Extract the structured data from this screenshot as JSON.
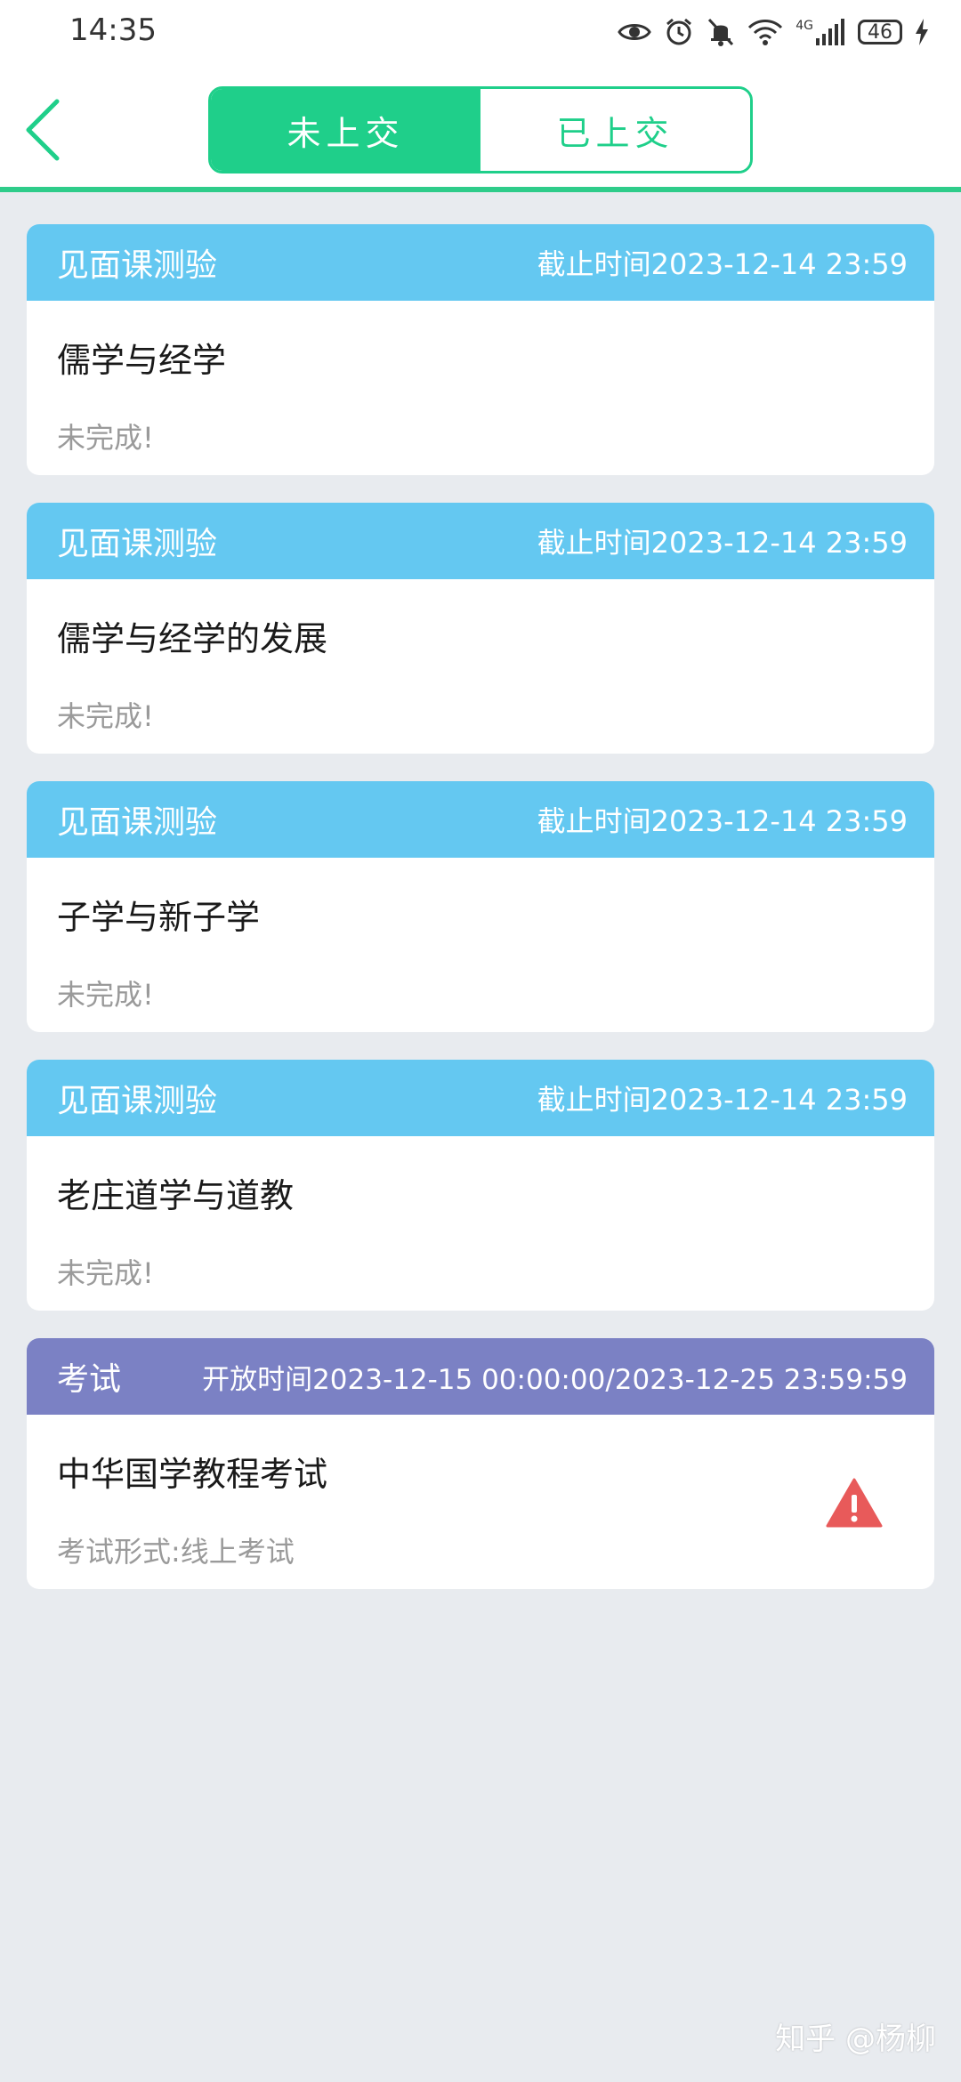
{
  "status_bar": {
    "time": "14:35",
    "network": "4G",
    "battery": "46",
    "icons": [
      "eye-icon",
      "alarm-icon",
      "mute-icon",
      "wifi-icon",
      "signal-icon",
      "battery-icon",
      "charging-icon"
    ]
  },
  "tabs": [
    {
      "label": "未上交",
      "active": true
    },
    {
      "label": "已上交",
      "active": false
    }
  ],
  "colors": {
    "accent": "#1fcf8a",
    "quiz_header": "#64c8f1",
    "exam_header": "#7b81c4",
    "warning": "#e85a5a",
    "background": "#e8ebef"
  },
  "cards": [
    {
      "type": "见面课测验",
      "time": "截止时间2023-12-14 23:59",
      "title": "儒学与经学",
      "status": "未完成!"
    },
    {
      "type": "见面课测验",
      "time": "截止时间2023-12-14 23:59",
      "title": "儒学与经学的发展",
      "status": "未完成!"
    },
    {
      "type": "见面课测验",
      "time": "截止时间2023-12-14 23:59",
      "title": "子学与新子学",
      "status": "未完成!"
    },
    {
      "type": "见面课测验",
      "time": "截止时间2023-12-14 23:59",
      "title": "老庄道学与道教",
      "status": "未完成!"
    },
    {
      "type": "考试",
      "time": "开放时间2023-12-15 00:00:00/2023-12-25 23:59:59",
      "title": "中华国学教程考试",
      "status": "考试形式:线上考试",
      "icon": "warning-icon"
    }
  ],
  "watermark": "知乎 @杨柳"
}
